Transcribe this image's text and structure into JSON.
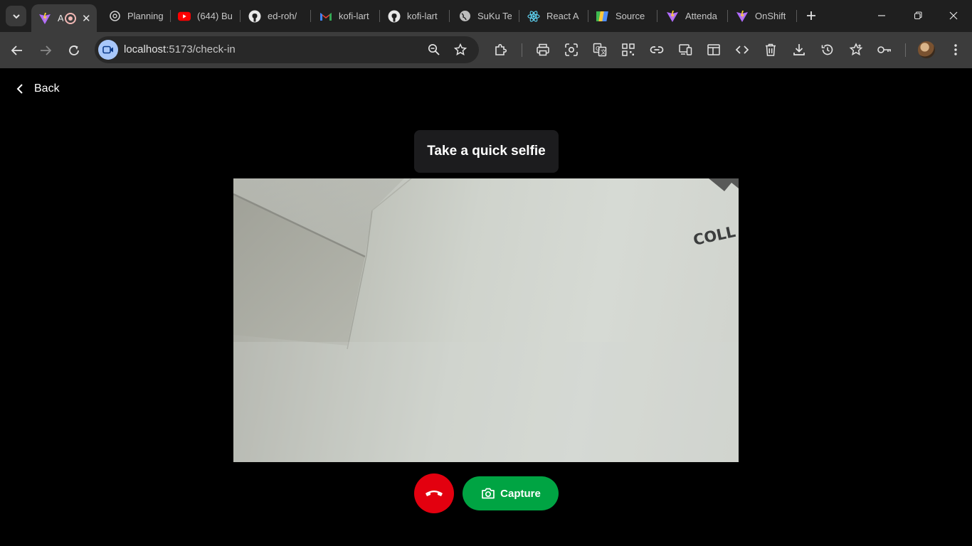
{
  "browser": {
    "tabs": [
      {
        "title": "A",
        "favicon": "vite-icon",
        "active": true
      },
      {
        "title": "Planning",
        "favicon": "chatgpt-icon"
      },
      {
        "title": "(644) Bu",
        "favicon": "youtube-icon"
      },
      {
        "title": "ed-roh/",
        "favicon": "github-icon"
      },
      {
        "title": "kofi-lart",
        "favicon": "gmail-icon"
      },
      {
        "title": "kofi-lart",
        "favicon": "github-icon"
      },
      {
        "title": "SuKu Te",
        "favicon": "globe-icon"
      },
      {
        "title": "React A",
        "favicon": "react-icon"
      },
      {
        "title": "Source",
        "favicon": "source-icon"
      },
      {
        "title": "Attenda",
        "favicon": "vite-icon"
      },
      {
        "title": "OnShift",
        "favicon": "vite-icon"
      }
    ],
    "address": {
      "host": "localhost",
      "path": ":5173/check-in"
    }
  },
  "page": {
    "back_label": "Back",
    "heading": "Take a quick selfie",
    "camera_wall_text": "COLL",
    "capture_label": "Capture"
  },
  "colors": {
    "end_call": "#e3000f",
    "capture": "#00a443",
    "heading_bg": "#1c1c1e"
  }
}
